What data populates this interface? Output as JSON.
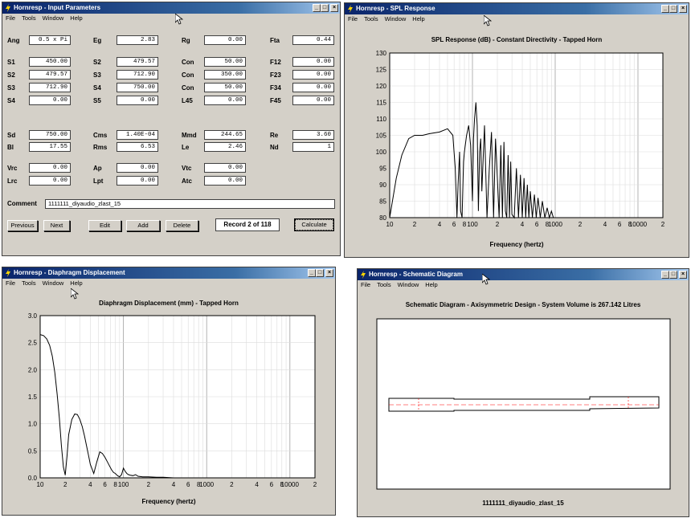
{
  "menu": [
    "File",
    "Tools",
    "Window",
    "Help"
  ],
  "input_window": {
    "title": "Hornresp - Input Parameters",
    "rows1": [
      [
        {
          "l": "Ang",
          "v": "0.5 x Pi"
        },
        {
          "l": "Eg",
          "v": "2.83"
        },
        {
          "l": "Rg",
          "v": "0.00"
        },
        {
          "l": "Fta",
          "v": "0.44"
        }
      ],
      [
        {
          "l": "S1",
          "v": "450.00"
        },
        {
          "l": "S2",
          "v": "479.57"
        },
        {
          "l": "Con",
          "v": "50.00"
        },
        {
          "l": "F12",
          "v": "0.00"
        }
      ],
      [
        {
          "l": "S2",
          "v": "479.57"
        },
        {
          "l": "S3",
          "v": "712.90"
        },
        {
          "l": "Con",
          "v": "350.00"
        },
        {
          "l": "F23",
          "v": "0.00"
        }
      ],
      [
        {
          "l": "S3",
          "v": "712.90"
        },
        {
          "l": "S4",
          "v": "750.00"
        },
        {
          "l": "Con",
          "v": "50.00"
        },
        {
          "l": "F34",
          "v": "0.00"
        }
      ],
      [
        {
          "l": "S4",
          "v": "0.00"
        },
        {
          "l": "S5",
          "v": "0.00"
        },
        {
          "l": "L45",
          "v": "0.00"
        },
        {
          "l": "F45",
          "v": "0.00"
        }
      ]
    ],
    "rows2": [
      [
        {
          "l": "Sd",
          "v": "750.00"
        },
        {
          "l": "Cms",
          "v": "1.40E-04"
        },
        {
          "l": "Mmd",
          "v": "244.65"
        },
        {
          "l": "Re",
          "v": "3.60"
        }
      ],
      [
        {
          "l": "Bl",
          "v": "17.55"
        },
        {
          "l": "Rms",
          "v": "6.53"
        },
        {
          "l": "Le",
          "v": "2.46"
        },
        {
          "l": "Nd",
          "v": "1"
        }
      ]
    ],
    "rows3": [
      [
        {
          "l": "Vrc",
          "v": "0.00"
        },
        {
          "l": "Ap",
          "v": "0.00"
        },
        {
          "l": "Vtc",
          "v": "0.00"
        }
      ],
      [
        {
          "l": "Lrc",
          "v": "0.00"
        },
        {
          "l": "Lpt",
          "v": "0.00"
        },
        {
          "l": "Atc",
          "v": "0.00"
        }
      ]
    ],
    "comment_label": "Comment",
    "comment": "1111111_diyaudio_zlast_15",
    "buttons": {
      "previous": "Previous",
      "next": "Next",
      "edit": "Edit",
      "add": "Add",
      "delete": "Delete",
      "calculate": "Calculate"
    },
    "record": "Record 2 of 118"
  },
  "spl_window": {
    "title": "Hornresp - SPL Response",
    "chart_data": {
      "type": "line",
      "title": "SPL Response (dB) - Constant Directivity - Tapped Horn",
      "xlabel": "Frequency (hertz)",
      "ylabel": "",
      "x_scale": "log",
      "xlim": [
        10,
        20000
      ],
      "ylim": [
        80,
        130
      ],
      "y_ticks": [
        80,
        85,
        90,
        95,
        100,
        105,
        110,
        115,
        120,
        125,
        130
      ],
      "x_tick_labels": [
        "10",
        "2",
        "4",
        "6",
        "8",
        "100",
        "2",
        "4",
        "6",
        "8",
        "1000",
        "2",
        "4",
        "6",
        "8",
        "10000",
        "2"
      ],
      "x_tick_values": [
        10,
        20,
        40,
        60,
        80,
        100,
        200,
        400,
        600,
        800,
        1000,
        2000,
        4000,
        6000,
        8000,
        10000,
        20000
      ],
      "grid": true,
      "series": [
        {
          "x": [
            10,
            12,
            14,
            17,
            20,
            25,
            30,
            40,
            50,
            58,
            62,
            65,
            67,
            70,
            72,
            75,
            78,
            80,
            85,
            90,
            95,
            100,
            103,
            106,
            110,
            114,
            118,
            122,
            126,
            130,
            140,
            150,
            160,
            170,
            180,
            190,
            200,
            210,
            220,
            230,
            240,
            250,
            260,
            270,
            280,
            290,
            300,
            320,
            340,
            360,
            380,
            400,
            420,
            440,
            460,
            480,
            500,
            530,
            560,
            590,
            620,
            660,
            700,
            750,
            800,
            850,
            900,
            950,
            1000
          ],
          "y": [
            80,
            92,
            99,
            104,
            105,
            105,
            105.5,
            106,
            107,
            105,
            95,
            80,
            90,
            100,
            82,
            80,
            97,
            100,
            105,
            108,
            102,
            85,
            104,
            110,
            115,
            108,
            82,
            100,
            104,
            88,
            108,
            80,
            95,
            106,
            80,
            104,
            92,
            80,
            102,
            80,
            103,
            82,
            80,
            99,
            80,
            97,
            81,
            80,
            95,
            80,
            93,
            80,
            92,
            80,
            90,
            80,
            88,
            80,
            87,
            80,
            86,
            80,
            85,
            80,
            83,
            80,
            82,
            80,
            80
          ]
        }
      ]
    }
  },
  "disp_window": {
    "title": "Hornresp - Diaphragm Displacement",
    "chart_data": {
      "type": "line",
      "title": "Diaphragm Displacement (mm) - Tapped Horn",
      "xlabel": "Frequency (hertz)",
      "ylabel": "",
      "x_scale": "log",
      "xlim": [
        10,
        20000
      ],
      "ylim": [
        0,
        3
      ],
      "y_ticks": [
        "0.0",
        "0.5",
        "1.0",
        "1.5",
        "2.0",
        "2.5",
        "3.0"
      ],
      "x_tick_labels": [
        "10",
        "2",
        "4",
        "6",
        "8",
        "100",
        "2",
        "4",
        "6",
        "8",
        "1000",
        "2",
        "4",
        "6",
        "8",
        "10000",
        "2"
      ],
      "x_tick_values": [
        10,
        20,
        40,
        60,
        80,
        100,
        200,
        400,
        600,
        800,
        1000,
        2000,
        4000,
        6000,
        8000,
        10000,
        20000
      ],
      "grid": true,
      "series": [
        {
          "x": [
            10,
            11,
            12,
            13,
            14,
            15,
            16,
            17,
            18,
            19,
            20,
            21,
            22,
            24,
            26,
            28,
            30,
            32,
            34,
            36,
            38,
            40,
            44,
            48,
            52,
            56,
            60,
            64,
            68,
            72,
            76,
            80,
            85,
            90,
            95,
            100,
            105,
            110,
            115,
            120,
            130,
            140,
            150,
            170,
            200,
            250,
            300,
            400,
            500
          ],
          "y": [
            2.65,
            2.63,
            2.57,
            2.45,
            2.25,
            1.95,
            1.55,
            1.1,
            0.6,
            0.2,
            0.05,
            0.4,
            0.8,
            1.08,
            1.18,
            1.17,
            1.08,
            0.95,
            0.78,
            0.6,
            0.42,
            0.25,
            0.08,
            0.3,
            0.48,
            0.45,
            0.38,
            0.3,
            0.22,
            0.15,
            0.1,
            0.08,
            0.04,
            0.02,
            0.06,
            0.18,
            0.12,
            0.08,
            0.06,
            0.05,
            0.04,
            0.06,
            0.03,
            0.02,
            0.02,
            0.01,
            0.01,
            0.0,
            0.0
          ]
        }
      ]
    }
  },
  "schem_window": {
    "title": "Hornresp - Schematic Diagram",
    "heading": "Schematic Diagram - Axisymmetric Design - System Volume is 267.142 Litres",
    "footer": "1111111_diyaudio_zlast_15"
  },
  "colors": {
    "titlebar_start": "#0a246a",
    "titlebar_end": "#a6caf0",
    "face": "#d4d0c8",
    "grid": "#d0d0d0",
    "centerline": "#ff0000"
  }
}
